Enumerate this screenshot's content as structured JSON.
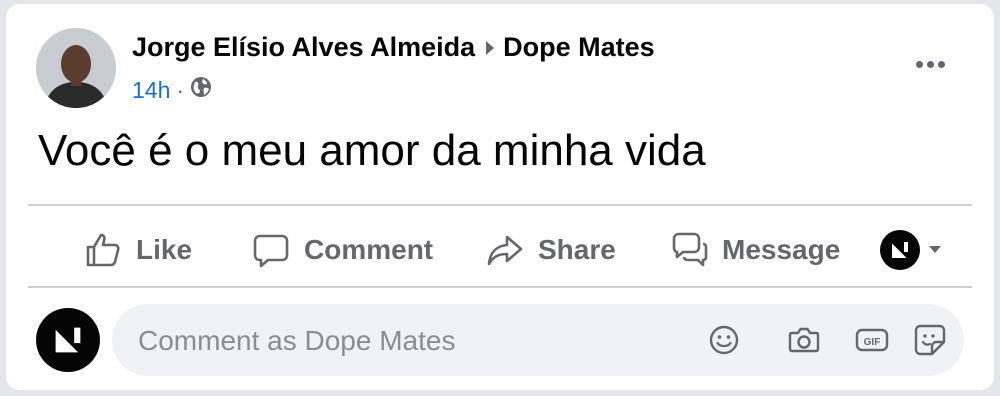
{
  "post": {
    "author_name": "Jorge Elísio Alves Almeida",
    "group_name": "Dope Mates",
    "timestamp": "14h",
    "separator": "·",
    "privacy_icon": "globe-icon",
    "body_text": "Você é o meu amor da minha vida"
  },
  "actions": {
    "like_label": "Like",
    "comment_label": "Comment",
    "share_label": "Share",
    "message_label": "Message"
  },
  "composer": {
    "placeholder": "Comment as Dope Mates",
    "tools": [
      "emoji-icon",
      "camera-icon",
      "gif-icon",
      "sticker-icon"
    ]
  },
  "colors": {
    "meta_link": "#1a6ed8",
    "action_text": "#65676b",
    "card_bg": "#ffffff",
    "page_bg": "#e4e6eb"
  }
}
